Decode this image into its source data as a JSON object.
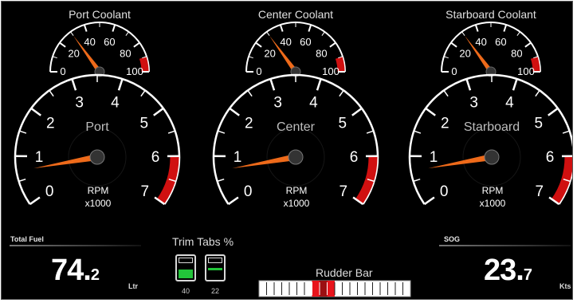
{
  "colors": {
    "background": "#000000",
    "needle": "#ee6a1a",
    "redline": "#d01010",
    "active_segment": "#e8141c",
    "trim_fill": "#22c43a"
  },
  "coolant_gauges": [
    {
      "id": "port",
      "title": "Port Coolant",
      "labels": [
        "0",
        "20",
        "40",
        "60",
        "80",
        "100"
      ],
      "value": 30,
      "max": 100
    },
    {
      "id": "center",
      "title": "Center Coolant",
      "labels": [
        "0",
        "20",
        "40",
        "60",
        "80",
        "100"
      ],
      "value": 30,
      "max": 100
    },
    {
      "id": "starboard",
      "title": "Starboard Coolant",
      "labels": [
        "0",
        "20",
        "40",
        "60",
        "80",
        "100"
      ],
      "value": 30,
      "max": 100
    }
  ],
  "rpm_gauges": [
    {
      "id": "port",
      "name": "Port",
      "labels": [
        "0",
        "1",
        "2",
        "3",
        "4",
        "5",
        "6",
        "7"
      ],
      "value": 0.7,
      "max": 7,
      "unit_line1": "RPM",
      "unit_line2": "x1000"
    },
    {
      "id": "center",
      "name": "Center",
      "labels": [
        "0",
        "1",
        "2",
        "3",
        "4",
        "5",
        "6",
        "7"
      ],
      "value": 0.7,
      "max": 7,
      "unit_line1": "RPM",
      "unit_line2": "x1000"
    },
    {
      "id": "starboard",
      "name": "Starboard",
      "labels": [
        "0",
        "1",
        "2",
        "3",
        "4",
        "5",
        "6",
        "7"
      ],
      "value": 0.7,
      "max": 7,
      "unit_line1": "RPM",
      "unit_line2": "x1000"
    }
  ],
  "total_fuel": {
    "label": "Total Fuel",
    "whole": "74.",
    "decimal": "2",
    "unit": "Ltr"
  },
  "trim_tabs": {
    "title": "Trim Tabs %",
    "port_value": "40",
    "starboard_value": "22",
    "port_fraction": 0.4,
    "starboard_fraction": 0.22
  },
  "rudder_bar": {
    "title": "Rudder Bar",
    "segments": 20,
    "active_from": 7,
    "active_to": 9,
    "dark_segment": 8
  },
  "sog": {
    "label": "SOG",
    "whole": "23.",
    "decimal": "7",
    "unit": "Kts"
  }
}
